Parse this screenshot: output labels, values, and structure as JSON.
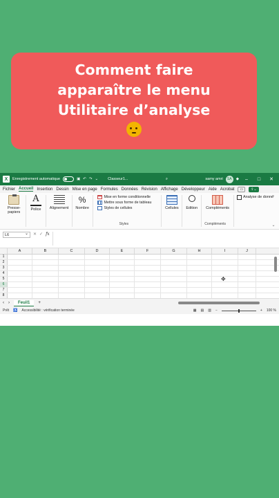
{
  "banner": {
    "lines": [
      "Comment faire",
      "apparaître le menu",
      "Utilitaire d’analyse"
    ],
    "emoji": "thinking-face-icon"
  },
  "titlebar": {
    "autosave_label": "Enregistrement automatique",
    "filename": "Classeur1...",
    "user_name": "samy amri",
    "win_minimize": "–",
    "win_maximize": "□",
    "win_close": "✕"
  },
  "menu": {
    "tabs": [
      "Fichier",
      "Accueil",
      "Insertion",
      "Dessin",
      "Mise en page",
      "Formules",
      "Données",
      "Révision",
      "Affichage",
      "Développeur",
      "Aide",
      "Acrobat"
    ],
    "active_tab": "Accueil"
  },
  "ribbon": {
    "paste_label": "Presse-papiers",
    "font_label": "Police",
    "align_label": "Alignement",
    "number_label": "Nombre",
    "conditional_format": "Mise en forme conditionnelle",
    "format_table": "Mettre sous forme de tableau",
    "cell_styles": "Styles de cellules",
    "styles_group": "Styles",
    "cells_label": "Cellules",
    "edit_label": "Edition",
    "complements_label": "Compléments",
    "complements_group": "Compléments",
    "analyse_label": "Analyse de donné"
  },
  "formula_bar": {
    "cell_ref": "L6",
    "fx": "fx",
    "cancel": "✕",
    "confirm": "✓"
  },
  "grid": {
    "columns": [
      "A",
      "B",
      "C",
      "D",
      "E",
      "F",
      "G",
      "H",
      "I",
      "J"
    ],
    "rows": [
      "1",
      "2",
      "3",
      "4",
      "5",
      "6",
      "7",
      "8"
    ],
    "selected_row": "6"
  },
  "sheets": {
    "tabs": [
      "Feuil1"
    ],
    "add": "+"
  },
  "status": {
    "mode": "Prêt",
    "accessibility": "Accessibilité : vérification terminée",
    "zoom": "100 %"
  }
}
